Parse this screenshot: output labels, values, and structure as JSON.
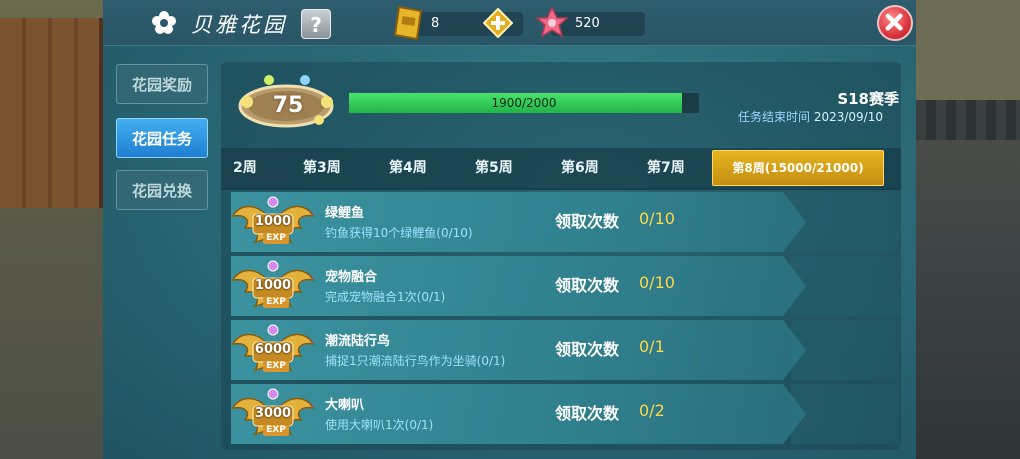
{
  "header": {
    "title": "贝雅花园",
    "help_label": "?",
    "gold_amount": "8",
    "petal_amount": "520"
  },
  "side_tabs": [
    {
      "label": "花园奖励",
      "active": false
    },
    {
      "label": "花园任务",
      "active": true
    },
    {
      "label": "花园兑换",
      "active": false
    }
  ],
  "level": {
    "value": "75"
  },
  "progress": {
    "text": "1900/2000",
    "current": 1900,
    "max": 2000
  },
  "season": {
    "name": "S18赛季",
    "end_label": "任务结束时间",
    "end_date": "2023/09/10"
  },
  "weeks": [
    {
      "label": "2周"
    },
    {
      "label": "第3周"
    },
    {
      "label": "第4周"
    },
    {
      "label": "第5周"
    },
    {
      "label": "第6周"
    },
    {
      "label": "第7周"
    },
    {
      "label": "第8周(15000/21000)",
      "active": true
    }
  ],
  "claim_label": "领取次数",
  "exp_tag": "EXP",
  "tasks": [
    {
      "exp": "1000",
      "name": "绿鲤鱼",
      "desc": "钓鱼获得10个绿鲤鱼(0/10)",
      "count": "0/10"
    },
    {
      "exp": "1000",
      "name": "宠物融合",
      "desc": "完成宠物融合1次(0/1)",
      "count": "0/10"
    },
    {
      "exp": "6000",
      "name": "潮流陆行鸟",
      "desc": "捕捉1只潮流陆行鸟作为坐骑(0/1)",
      "count": "0/1"
    },
    {
      "exp": "3000",
      "name": "大喇叭",
      "desc": "使用大喇叭1次(0/1)",
      "count": "0/2"
    }
  ],
  "colors": {
    "accent_blue": "#2a8fe0",
    "gold": "#e2ad1e",
    "progress_green": "#33cc55",
    "close_red": "#d8363e"
  }
}
